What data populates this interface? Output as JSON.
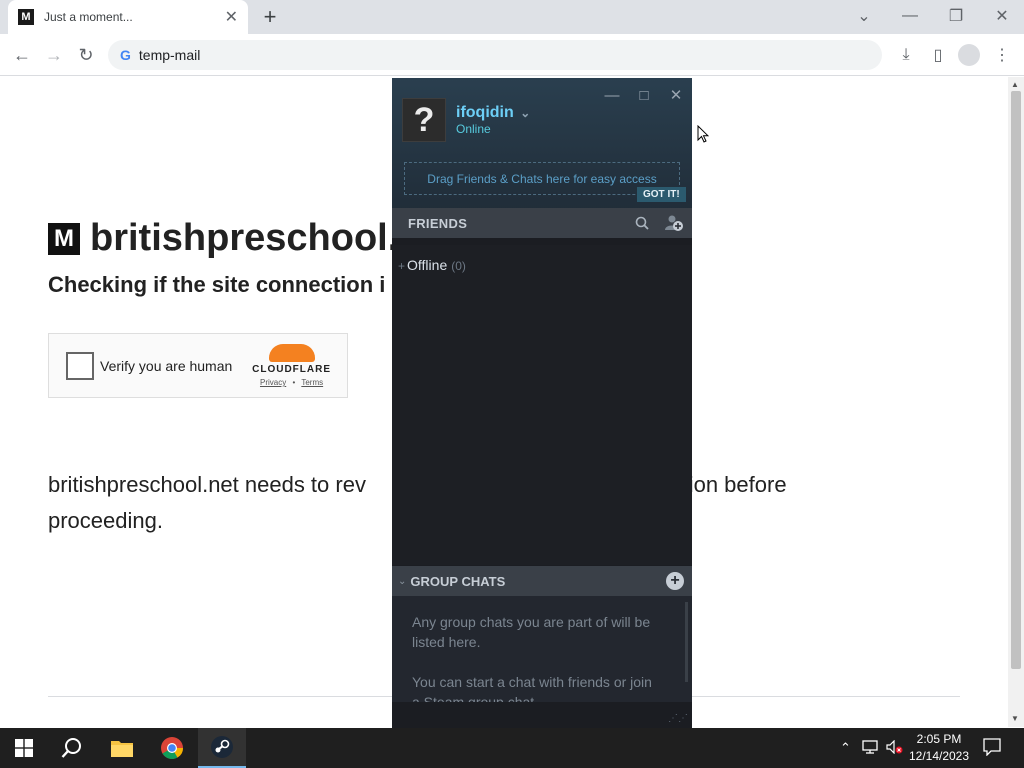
{
  "browser": {
    "tab_title": "Just a moment...",
    "tab_favicon": "M",
    "new_tab": "+",
    "url": "temp-mail",
    "window_controls": {
      "dropdown": "⌄",
      "minimize": "—",
      "restore": "❐",
      "close": "✕"
    },
    "nav": {
      "back": "←",
      "forward": "→",
      "reload": "↻"
    },
    "toolbar_icons": {
      "download": "⤓",
      "sidebar": "▯",
      "menu": "⋮"
    }
  },
  "page": {
    "logo_letter": "M",
    "site_title": "britishpreschool.",
    "subtitle": "Checking if the site connection i",
    "captcha": {
      "label": "Verify you are human",
      "brand": "CLOUDFLARE",
      "privacy": "Privacy",
      "separator": "•",
      "terms": "Terms"
    },
    "body_line1": "britishpreschool.net needs to rev                                              nection before",
    "body_line2": "proceeding."
  },
  "steam": {
    "avatar_glyph": "?",
    "username": "ifoqidin",
    "username_caret": "⌄",
    "status": "Online",
    "window_controls": {
      "minimize": "—",
      "maximize": "□",
      "close": "✕"
    },
    "drop_hint": "Drag Friends & Chats here for easy access",
    "got_it": "GOT IT!",
    "friends_header": "FRIENDS",
    "offline_label": "Offline",
    "offline_count": "(0)",
    "group_chats_header": "GROUP CHATS",
    "group_chats_text1": "Any group chats you are part of will be listed here.",
    "group_chats_text2": "You can start a chat with friends or join a Steam group chat."
  },
  "taskbar": {
    "time": "2:05 PM",
    "date": "12/14/2023"
  },
  "colors": {
    "steam_accent": "#6dcff6",
    "cloudflare_orange": "#f48120",
    "taskbar": "#1f1f1f"
  }
}
